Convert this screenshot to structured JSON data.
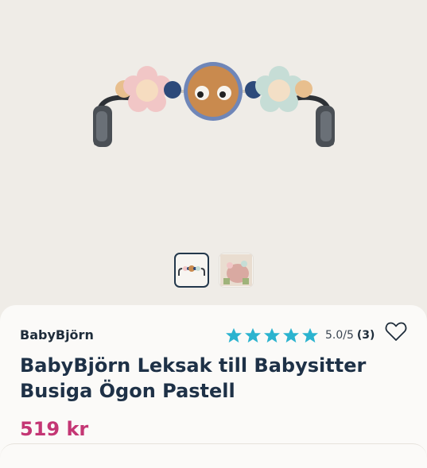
{
  "product": {
    "brand": "BabyBjörn",
    "title": "BabyBjörn Leksak till Babysitter Busiga Ögon Pastell",
    "price": "519 kr",
    "rating": {
      "score_text": "5.0/5",
      "count_text": "(3)",
      "stars": 5
    },
    "wishlist_icon": "heart-outline-icon"
  },
  "gallery": {
    "thumbnails": [
      {
        "name": "thumbnail-toy-bar",
        "selected": true
      },
      {
        "name": "thumbnail-lifestyle",
        "selected": false
      }
    ]
  },
  "colors": {
    "brand_text": "#1e2c3a",
    "price": "#c43674",
    "star": "#2bb3cf",
    "background": "#efece7",
    "card": "#fbfaf8"
  }
}
